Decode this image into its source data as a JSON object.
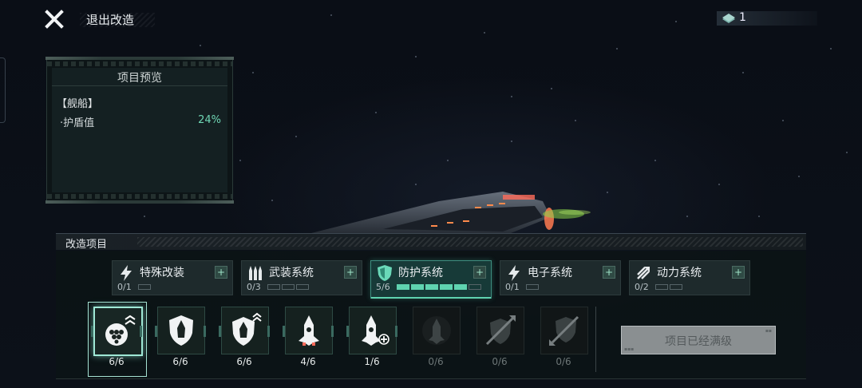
{
  "header": {
    "exit_label": "退出改造",
    "currency_value": "1"
  },
  "preview": {
    "title": "项目预览",
    "category": "【舰船】",
    "stat_label": "·护盾值",
    "stat_value": "24%"
  },
  "modification": {
    "header_label": "改造项目",
    "tabs": [
      {
        "label": "特殊改装",
        "count": "0/1",
        "filled": 0,
        "total": 1,
        "icon": "lightning-icon",
        "active": false
      },
      {
        "label": "武装系统",
        "count": "0/3",
        "filled": 0,
        "total": 3,
        "icon": "ammo-icon",
        "active": false
      },
      {
        "label": "防护系统",
        "count": "5/6",
        "filled": 5,
        "total": 6,
        "icon": "shield-icon",
        "active": true
      },
      {
        "label": "电子系统",
        "count": "0/1",
        "filled": 0,
        "total": 1,
        "icon": "lightning-icon",
        "active": false
      },
      {
        "label": "动力系统",
        "count": "0/2",
        "filled": 0,
        "total": 2,
        "icon": "thruster-icon",
        "active": false
      }
    ],
    "items": [
      {
        "count": "6/6",
        "icon": "hex-shield-upgrade-icon",
        "state": "selected"
      },
      {
        "count": "6/6",
        "icon": "shield-ship-icon",
        "state": "done"
      },
      {
        "count": "6/6",
        "icon": "shield-ship-upgrade-icon",
        "state": "done"
      },
      {
        "count": "4/6",
        "icon": "ship-icon",
        "state": "partial"
      },
      {
        "count": "1/6",
        "icon": "ship-plus-icon",
        "state": "partial"
      },
      {
        "count": "0/6",
        "icon": "ship-locked-icon",
        "state": "locked"
      },
      {
        "count": "0/6",
        "icon": "shield-pierce-icon",
        "state": "locked"
      },
      {
        "count": "0/6",
        "icon": "shield-pierce-down-icon",
        "state": "locked"
      }
    ],
    "maxed_label": "项目已经满级"
  },
  "colors": {
    "accent": "#5fd3b0",
    "panel": "#142022",
    "maxed_button": "#8a8f91"
  }
}
